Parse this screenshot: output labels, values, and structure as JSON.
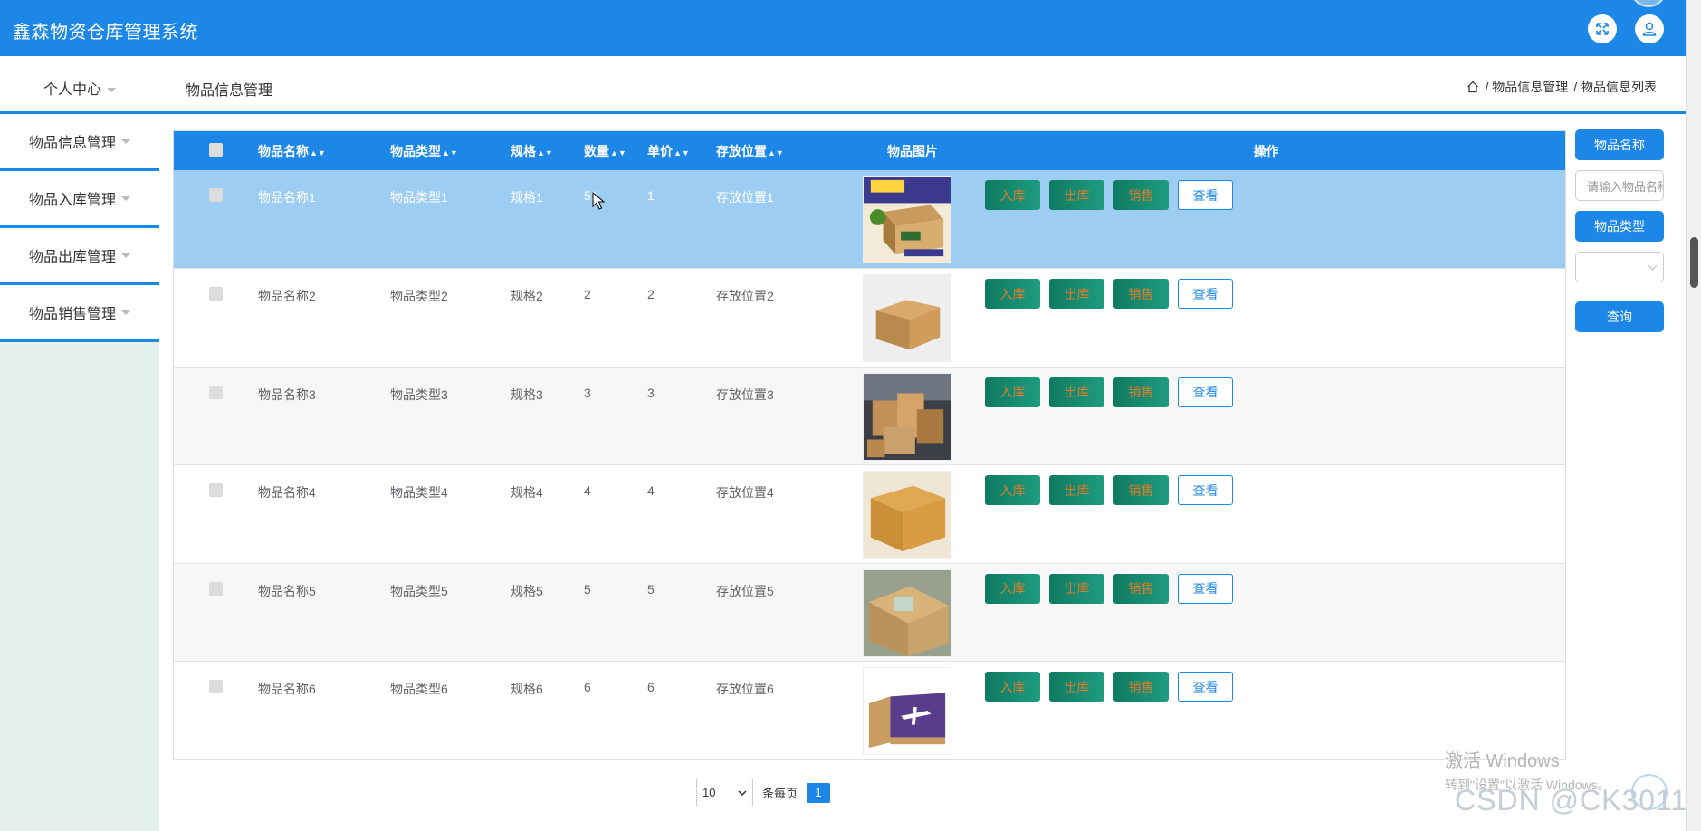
{
  "app": {
    "title": "鑫森物资仓库管理系统"
  },
  "navbar": {
    "personal_center": "个人中心",
    "page_title": "物品信息管理",
    "breadcrumb": [
      "/ 物品信息管理",
      "/ 物品信息列表"
    ]
  },
  "sidebar": {
    "items": [
      {
        "label": "物品信息管理"
      },
      {
        "label": "物品入库管理"
      },
      {
        "label": "物品出库管理"
      },
      {
        "label": "物品销售管理"
      }
    ]
  },
  "table": {
    "columns": {
      "name": "物品名称",
      "type": "物品类型",
      "spec": "规格",
      "qty": "数量",
      "price": "单价",
      "location": "存放位置",
      "image": "物品图片",
      "ops": "操作"
    },
    "rows": [
      {
        "name": "物品名称1",
        "type": "物品类型1",
        "spec": "规格1",
        "qty": "51",
        "price": "1",
        "location": "存放位置1",
        "image": "box-printed"
      },
      {
        "name": "物品名称2",
        "type": "物品类型2",
        "spec": "规格2",
        "qty": "2",
        "price": "2",
        "location": "存放位置2",
        "image": "box-plain"
      },
      {
        "name": "物品名称3",
        "type": "物品类型3",
        "spec": "规格3",
        "qty": "3",
        "price": "3",
        "location": "存放位置3",
        "image": "boxes-pile"
      },
      {
        "name": "物品名称4",
        "type": "物品类型4",
        "spec": "规格4",
        "qty": "4",
        "price": "4",
        "location": "存放位置4",
        "image": "box-open"
      },
      {
        "name": "物品名称5",
        "type": "物品类型5",
        "spec": "规格5",
        "qty": "5",
        "price": "5",
        "location": "存放位置5",
        "image": "box-taped"
      },
      {
        "name": "物品名称6",
        "type": "物品类型6",
        "spec": "规格6",
        "qty": "6",
        "price": "6",
        "location": "存放位置6",
        "image": "box-airplane"
      }
    ],
    "actions": {
      "in": "入库",
      "out": "出库",
      "sell": "销售",
      "view": "查看"
    }
  },
  "pagination": {
    "page_size": "10",
    "per_page_label": "条每页",
    "current_page": "1"
  },
  "search": {
    "name_label": "物品名称",
    "name_placeholder": "请输入物品名称",
    "type_label": "物品类型",
    "type_value": "",
    "search_button": "查询"
  },
  "overlay": {
    "windows_line1": "激活 Windows",
    "windows_line2": "转到\"设置\"以激活 Windows。",
    "csdn": "CSDN @CK3011"
  },
  "colors": {
    "primary": "#1c87e6",
    "selected_row": "#9ecdf3",
    "action_green": "#0e7a62",
    "action_text": "#e07b2b"
  }
}
